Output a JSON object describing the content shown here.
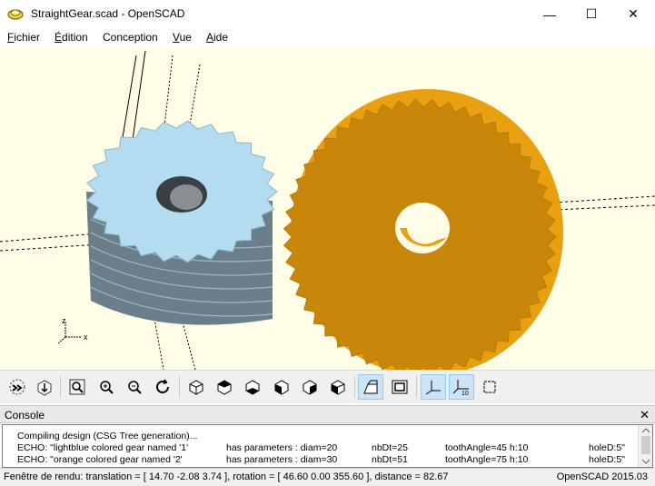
{
  "window": {
    "title": "StraightGear.scad - OpenSCAD",
    "minimize_glyph": "—",
    "maximize_glyph": "☐",
    "close_glyph": "✕"
  },
  "menu": [
    {
      "label_u": "F",
      "label_rest": "ichier"
    },
    {
      "label_u": "É",
      "label_rest": "dition"
    },
    {
      "label_u": "",
      "label_rest": "Conception"
    },
    {
      "label_u": "V",
      "label_rest": "ue"
    },
    {
      "label_u": "A",
      "label_rest": "ide"
    }
  ],
  "viewport": {
    "background": "#fffde6",
    "light_gear_color": "#b4dcf0",
    "orange_gear_color": "#d9920a",
    "axis_x_label": "x",
    "axis_z_label": "z"
  },
  "toolbar": {
    "icons": [
      "preview-icon",
      "render-icon",
      "view-all-icon",
      "zoom-in-icon",
      "zoom-out-icon",
      "reset-view-icon",
      "view-right-icon",
      "view-top-icon",
      "view-bottom-icon",
      "view-left-icon",
      "view-front-icon",
      "view-back-icon",
      "perspective-icon",
      "orthogonal-icon",
      "show-axes-icon",
      "show-scale-icon",
      "show-edges-icon"
    ]
  },
  "console": {
    "title": "Console",
    "close_glyph": "✕",
    "lines": [
      {
        "text": "Compiling design (CSG Tree generation)..."
      },
      {
        "text": "ECHO: \"lightblue colored gear named '1'",
        "params": "has parameters : diam=20",
        "nbdt": "nbDt=25",
        "angle": "toothAngle=45  h:10",
        "hole": "holeD:5\""
      },
      {
        "text": "ECHO: \"orange colored gear named '2'",
        "params": "has parameters : diam=30",
        "nbdt": "nbDt=51",
        "angle": "toothAngle=75  h:10",
        "hole": "holeD:5\""
      }
    ]
  },
  "status": {
    "left": "Fenêtre de rendu: translation = [ 14.70 -2.08 3.74 ], rotation = [ 46.60 0.00 355.60 ], distance = 82.67",
    "right": "OpenSCAD 2015.03"
  }
}
